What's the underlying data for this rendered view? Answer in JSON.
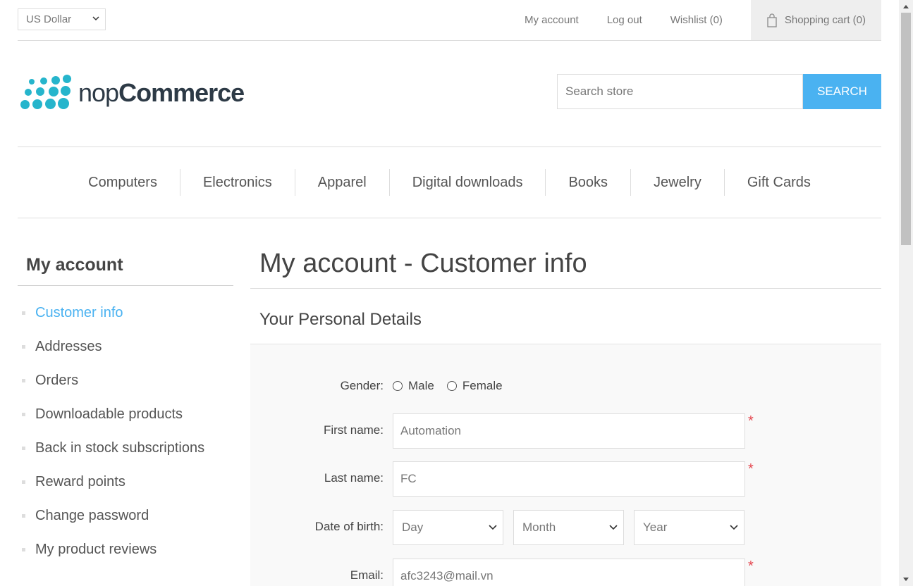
{
  "header": {
    "currency": "US Dollar",
    "links": {
      "my_account": "My account",
      "log_out": "Log out",
      "wishlist": "Wishlist (0)",
      "cart": "Shopping cart (0)"
    }
  },
  "logo": {
    "prefix": "nop",
    "suffix": "Commerce",
    "color": "#26b5cc"
  },
  "search": {
    "placeholder": "Search store",
    "button": "SEARCH",
    "accent": "#4ab2f1"
  },
  "nav": [
    "Computers",
    "Electronics",
    "Apparel",
    "Digital downloads",
    "Books",
    "Jewelry",
    "Gift Cards"
  ],
  "sidebar": {
    "title": "My account",
    "items": [
      "Customer info",
      "Addresses",
      "Orders",
      "Downloadable products",
      "Back in stock subscriptions",
      "Reward points",
      "Change password",
      "My product reviews"
    ],
    "active_index": 0
  },
  "main": {
    "title": "My account - Customer info",
    "section": "Your Personal Details",
    "form": {
      "gender_label": "Gender:",
      "gender_male": "Male",
      "gender_female": "Female",
      "first_name_label": "First name:",
      "first_name_value": "Automation",
      "last_name_label": "Last name:",
      "last_name_value": "FC",
      "dob_label": "Date of birth:",
      "dob_day": "Day",
      "dob_month": "Month",
      "dob_year": "Year",
      "email_label": "Email:",
      "email_value": "afc3243@mail.vn",
      "required_mark": "*"
    }
  }
}
